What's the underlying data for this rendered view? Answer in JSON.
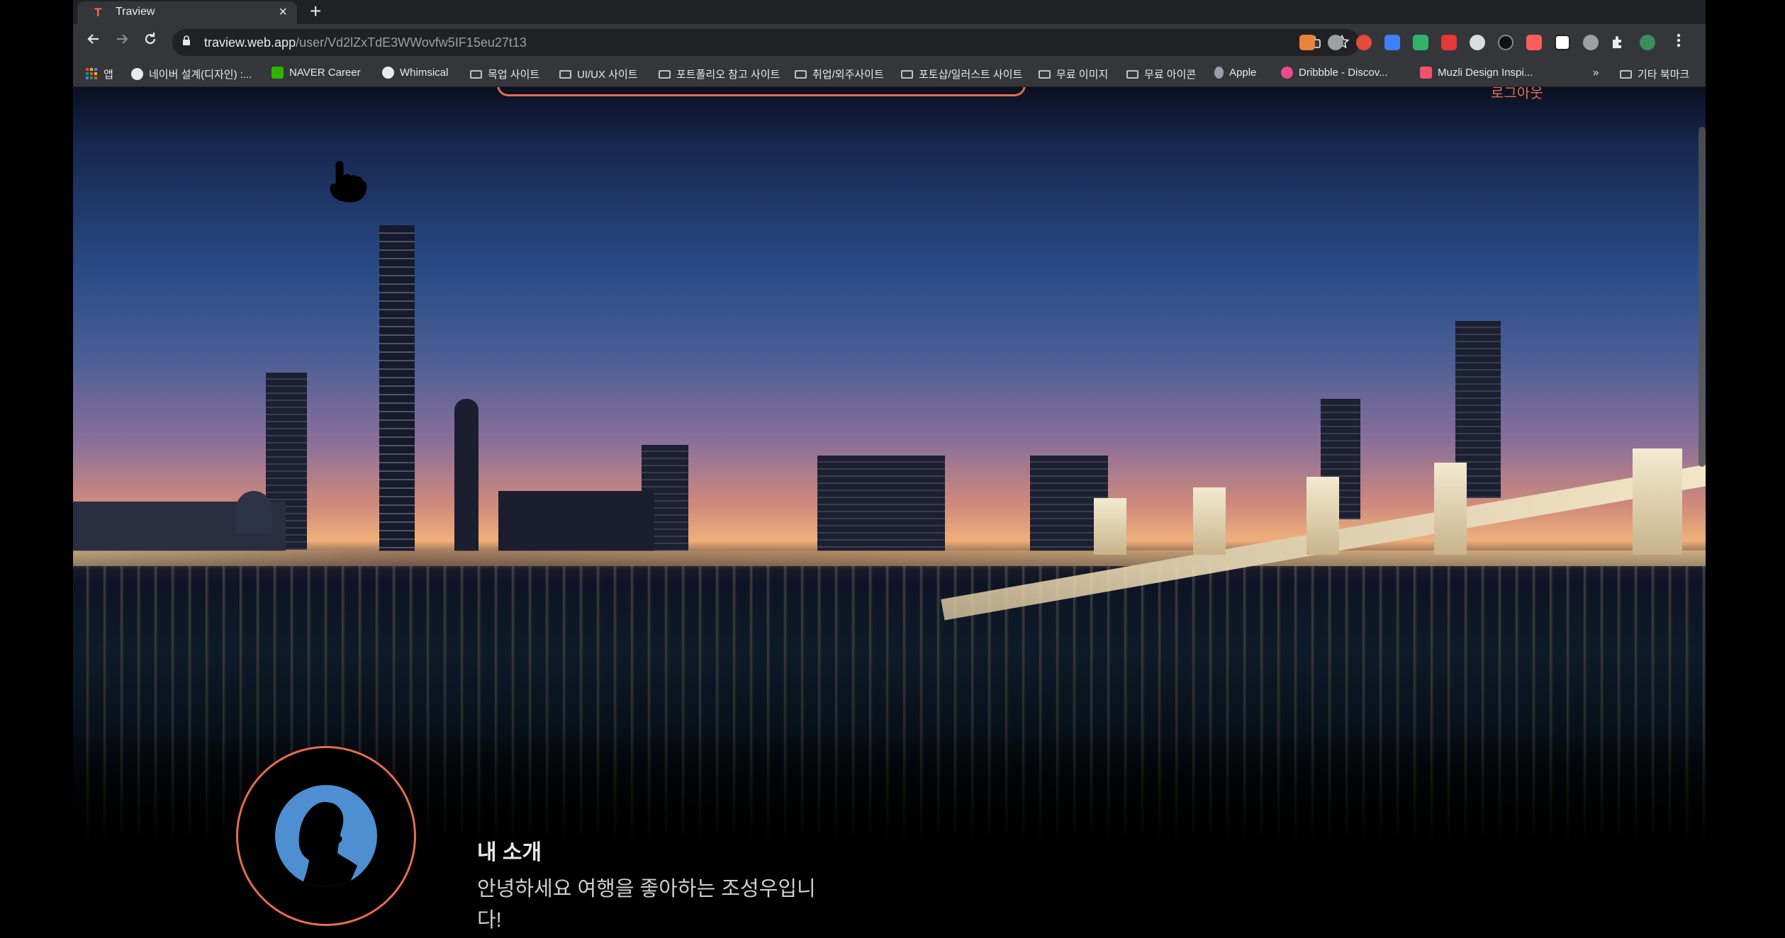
{
  "browser": {
    "tab": {
      "title": "Traview",
      "close_glyph": "×",
      "favicon": "T"
    },
    "new_tab_glyph": "+",
    "url": {
      "host": "traview.web.app",
      "path": "/user/Vd2lZxTdE3WWovfw5IF15eu27t13"
    },
    "bookmarks": [
      {
        "label": "앱",
        "icon": "apps-grid-icon"
      },
      {
        "label": "네이버 설계(디자인) :...",
        "icon": "globe-icon"
      },
      {
        "label": "NAVER Career",
        "icon": "naver-icon"
      },
      {
        "label": "Whimsical",
        "icon": "globe-icon"
      },
      {
        "label": "목업 사이트",
        "icon": "folder-icon"
      },
      {
        "label": "UI/UX 사이트",
        "icon": "folder-icon"
      },
      {
        "label": "포트폴리오 참고 사이트",
        "icon": "folder-icon"
      },
      {
        "label": "취업/외주사이트",
        "icon": "folder-icon"
      },
      {
        "label": "포토샵/일러스트 사이트",
        "icon": "folder-icon"
      },
      {
        "label": "무료 이미지",
        "icon": "folder-icon"
      },
      {
        "label": "무료 아이콘",
        "icon": "folder-icon"
      },
      {
        "label": "Apple",
        "icon": "apple-icon"
      },
      {
        "label": "Dribbble - Discov...",
        "icon": "dribbble-icon"
      },
      {
        "label": "Muzli Design Inspi...",
        "icon": "muzli-icon"
      }
    ],
    "overflow_glyph": "»",
    "other_bookmarks": "기타 북마크"
  },
  "page": {
    "logout_label": "로그아웃",
    "intro_heading": "내 소개",
    "intro_text": "안녕하세요 여행을 좋아하는 조성우입니다!"
  },
  "colors": {
    "accent": "#e46d4f",
    "avatar_bg": "#4d8fd0",
    "chrome_dark": "#202124",
    "chrome_mid": "#35363a"
  }
}
